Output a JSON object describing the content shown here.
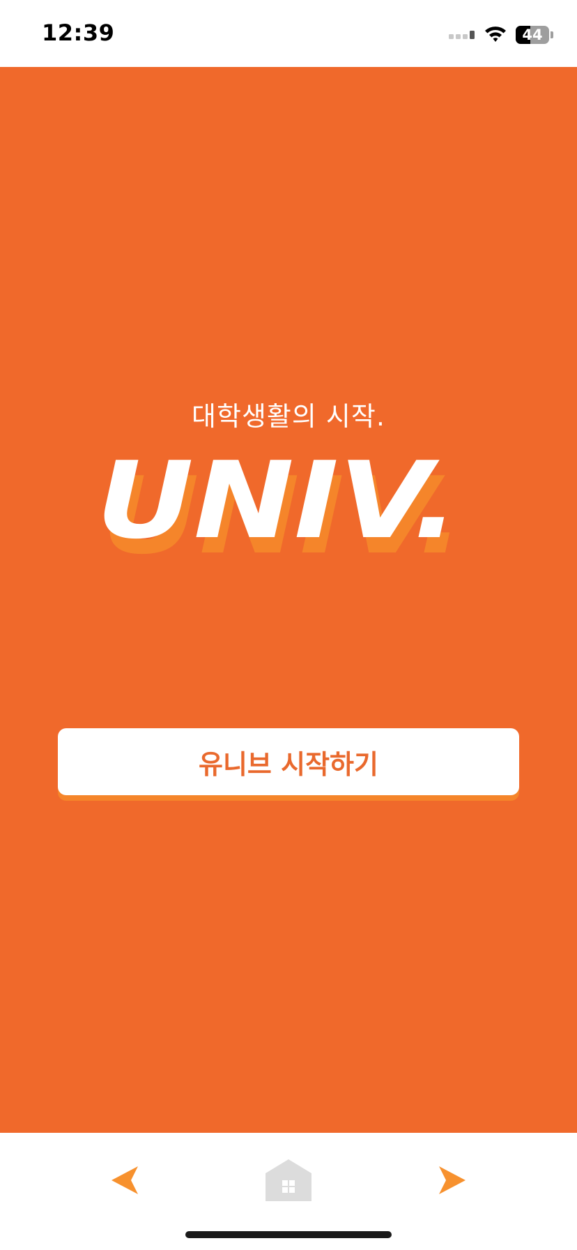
{
  "status_bar": {
    "time": "12:39",
    "battery_level": "44",
    "battery_fraction": 0.44,
    "icons": [
      "cellular-signal-icon",
      "wifi-icon",
      "battery-icon"
    ]
  },
  "splash": {
    "tagline": "대학생활의 시작.",
    "logo_text": "UNIV.",
    "start_button_label": "유니브 시작하기"
  },
  "toolbar": {
    "icons": [
      "back-arrow-icon",
      "home-icon",
      "forward-arrow-icon"
    ]
  },
  "colors": {
    "brand_orange": "#F0692B",
    "logo_shadow": "#F5852A",
    "button_text": "#E9692D",
    "home_icon_gray": "#DCDCDC",
    "white": "#FFFFFF"
  }
}
